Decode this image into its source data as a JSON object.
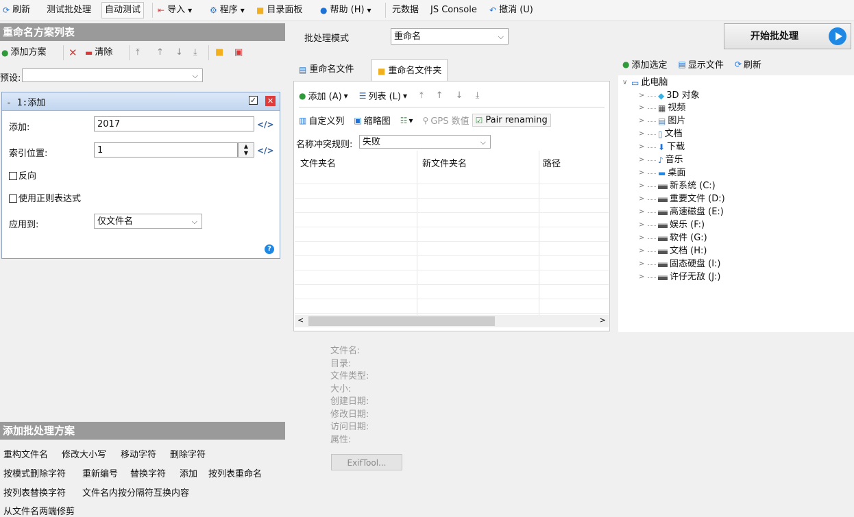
{
  "toolbar": {
    "refresh": "刷新",
    "test_batch": "测试批处理",
    "auto_test": "自动测试",
    "import": "导入",
    "program": "程序",
    "dir_panel": "目录面板",
    "help": "帮助 (H)",
    "metadata": "元数据",
    "js_console": "JS Console",
    "undo": "撤消 (U)"
  },
  "left": {
    "title": "重命名方案列表",
    "add_scheme": "添加方案",
    "clear": "清除",
    "preset_label": "预设:",
    "preset_value": "",
    "card": {
      "header": "- 1:添加",
      "add_label": "添加:",
      "add_value": "2017",
      "index_label": "索引位置:",
      "index_value": "1",
      "reverse": "反向",
      "regex": "使用正则表达式",
      "apply_label": "应用到:",
      "apply_value": "仅文件名"
    }
  },
  "bottom": {
    "title": "添加批处理方案",
    "actions_row1": [
      "重构文件名",
      "修改大小写",
      "移动字符",
      "删除字符"
    ],
    "actions_row2": [
      "按模式删除字符",
      "重新编号",
      "替换字符",
      "添加",
      "按列表重命名"
    ],
    "actions_row3": [
      "按列表替换字符",
      "文件名内按分隔符互换内容"
    ],
    "actions_row4": [
      "从文件名两端修剪"
    ]
  },
  "middle": {
    "mode_label": "批处理模式",
    "mode_value": "重命名",
    "tab_files": "重命名文件",
    "tab_folders": "重命名文件夹",
    "add": "添加 (A)",
    "list": "列表 (L)",
    "custom_cols": "自定义列",
    "thumbnails": "缩略图",
    "gps": "GPS 数值",
    "pair": "Pair renaming",
    "conflict_label": "名称冲突规则:",
    "conflict_value": "失败",
    "columns": [
      "文件夹名",
      "新文件夹名",
      "路径"
    ],
    "props": [
      "文件名:",
      "目录:",
      "文件类型:",
      "大小:",
      "创建日期:",
      "修改日期:",
      "访问日期:",
      "属性:"
    ],
    "exiftool": "ExifTool..."
  },
  "right": {
    "start": "开始批处理",
    "add_selected": "添加选定",
    "show_files": "显示文件",
    "refresh": "刷新",
    "tree_root": "此电脑",
    "tree_items": [
      "3D 对象",
      "视频",
      "图片",
      "文档",
      "下载",
      "音乐",
      "桌面",
      "新系统 (C:)",
      "重要文件 (D:)",
      "高速磁盘 (E:)",
      "娱乐 (F:)",
      "软件 (G:)",
      "文档 (H:)",
      "固态硬盘 (I:)",
      "许仔无敌 (J:)"
    ]
  }
}
